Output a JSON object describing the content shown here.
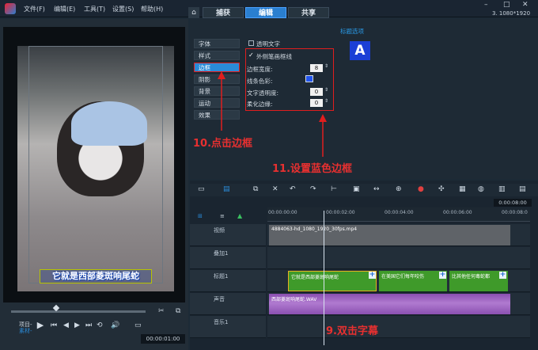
{
  "menubar": {
    "file": "文件(F)",
    "edit": "编辑(E)",
    "tools": "工具(T)",
    "settings": "设置(S)",
    "help": "帮助(H)",
    "tab_capture": "捕获",
    "tab_edit": "编辑",
    "tab_share": "共享",
    "resolution": "3. 1080*1920"
  },
  "preview": {
    "subtitle": "它就是西部菱斑响尾蛇",
    "label_project": "项目-",
    "label_clip": "素材-",
    "timecode": "00:00:01:00"
  },
  "options": {
    "title": "标题选项",
    "sample_letter": "A",
    "transparent_text": "透明文字",
    "outer_stroke": "外侧笔画框线",
    "border_width_label": "边框宽度:",
    "border_width": "8",
    "line_color_label": "线条色彩:",
    "line_color": "#2255ee",
    "text_opacity_label": "文字透明度:",
    "text_opacity": "0",
    "soft_edge_label": "柔化边缘:",
    "soft_edge": "0",
    "tabs": [
      "字体",
      "样式",
      "边框",
      "阴影",
      "背景",
      "运动",
      "效果"
    ]
  },
  "annotations": {
    "step10": "10.点击边框",
    "step11": "11.设置蓝色边框",
    "step9": "9.双击字幕"
  },
  "timeline": {
    "ruler": [
      "00:00:00:00",
      "00:00:02:00",
      "00:00:04:00",
      "00:00:06:00",
      "00:00:08:0"
    ],
    "current_time": "0:00:08:00",
    "tracks": [
      "视频",
      "叠加1",
      "标题1",
      "声音",
      "音乐1"
    ],
    "video_clip": "4884063-hd_1080_1920_30fps.mp4",
    "title_clips": [
      "它就是西部菱斑响尾蛇",
      "在美国它们每年咬伤",
      "比其他任何毒蛇都"
    ],
    "voice_clip": "西部菱斑响尾蛇.WAV"
  },
  "colors": {
    "accent": "#2a7fd0",
    "annotation": "#e01e1e",
    "title_clip": "#3f9a2a",
    "voice_clip": "#8a4fb0"
  }
}
